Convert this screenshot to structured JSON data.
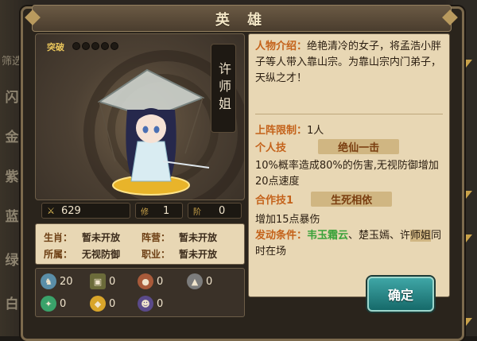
{
  "title": "英 雄",
  "side_tabs": [
    "筛选",
    "闪",
    "金",
    "紫",
    "蓝",
    "绿",
    "白"
  ],
  "hero": {
    "breakthrough_label": "突破",
    "name": "许师姐",
    "power": "629",
    "cultivation_label": "修",
    "cultivation": "1",
    "rank_label": "阶",
    "rank": "0"
  },
  "info": {
    "zodiac_label": "生肖：",
    "zodiac_value": "暂未开放",
    "camp_label": "阵营：",
    "camp_value": "暂未开放",
    "faction_label": "所属：",
    "faction_value": "无视防御",
    "job_label": "职业：",
    "job_value": "暂未开放"
  },
  "resources": [
    {
      "icon": "horse-icon",
      "value": "20"
    },
    {
      "icon": "armor-icon",
      "value": "0"
    },
    {
      "icon": "gourd-icon",
      "value": "0"
    },
    {
      "icon": "bell-icon",
      "value": "0"
    },
    {
      "icon": "spirit-icon",
      "value": "0"
    },
    {
      "icon": "shield-icon",
      "value": "0"
    },
    {
      "icon": "portrait-icon",
      "value": "0"
    }
  ],
  "details": {
    "intro_label": "人物介绍：",
    "intro_text": "绝艳清冷的女子，将孟浩小胖子等人带入靠山宗。为靠山宗内门弟子，天纵之才！",
    "limit_label": "上阵限制：",
    "limit_value": "1人",
    "skill_label": "个人技",
    "skill_name": "绝仙一击",
    "skill_desc": "10%概率造成80%的伤害,无视防御增加20点速度",
    "combo_label": "合作技1",
    "combo_name": "生死相依",
    "combo_desc": "增加15点暴伤",
    "trigger_label": "发动条件：",
    "trigger_green": "韦玉霜云",
    "trigger_rest1": "、楚玉嫣、许",
    "trigger_name_hi": "师姐",
    "trigger_rest2": "同时在场"
  },
  "confirm_label": "确定"
}
